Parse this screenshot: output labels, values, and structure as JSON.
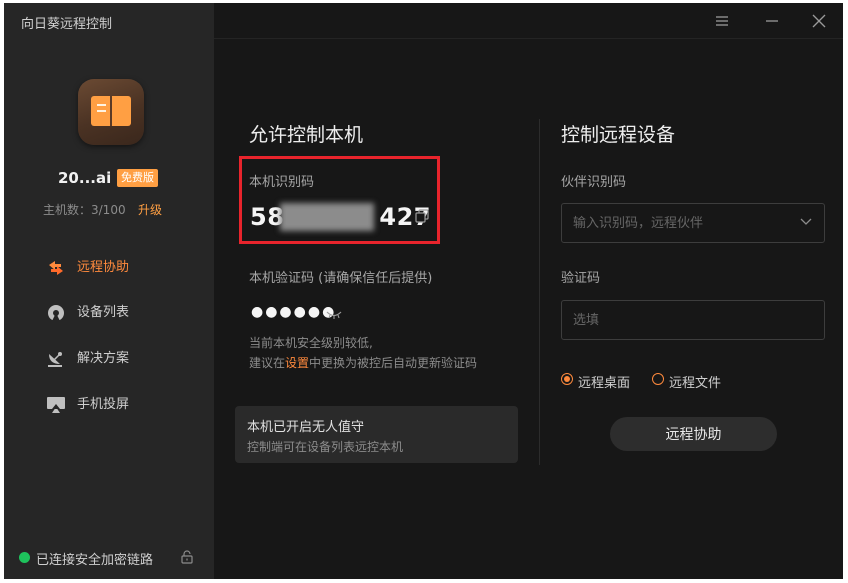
{
  "app": {
    "title": "向日葵远程控制"
  },
  "user": {
    "name": "20...ai",
    "plan_badge": "免费版",
    "host_count": "主机数：3/100",
    "upgrade": "升级"
  },
  "sidebar": {
    "items": [
      {
        "label": "远程协助",
        "icon": "remote-assist-icon",
        "active": true
      },
      {
        "label": "设备列表",
        "icon": "device-list-icon",
        "active": false
      },
      {
        "label": "解决方案",
        "icon": "satellite-dish-icon",
        "active": false
      },
      {
        "label": "手机投屏",
        "icon": "screen-cast-icon",
        "active": false
      }
    ]
  },
  "status": {
    "text": "已连接安全加密链路",
    "color": "#1ec25c"
  },
  "allow_control": {
    "title": "允许控制本机",
    "id_label": "本机识别码",
    "id_value_prefix": "58",
    "id_value_suffix": "427",
    "password_label": "本机验证码 (请确保信任后提供)",
    "password_masked": "●●●●●●",
    "notice_line1": "当前本机安全级别较低,",
    "notice_line2_pre": "建议在",
    "notice_line2_link": "设置",
    "notice_line2_post": "中更换为被控后自动更新验证码",
    "unattended_title": "本机已开启无人值守",
    "unattended_sub": "控制端可在设备列表远控本机"
  },
  "remote_control": {
    "title": "控制远程设备",
    "partner_label": "伙伴识别码",
    "partner_placeholder": "输入识别码，远程伙伴",
    "code_label": "验证码",
    "code_placeholder": "选填",
    "option_desktop": "远程桌面",
    "option_file": "远程文件",
    "selected_option": "远程桌面",
    "connect_button": "远程协助"
  },
  "colors": {
    "accent": "#ff8a3d",
    "highlight_box": "#e8242c",
    "badge": "#ff9f43"
  }
}
